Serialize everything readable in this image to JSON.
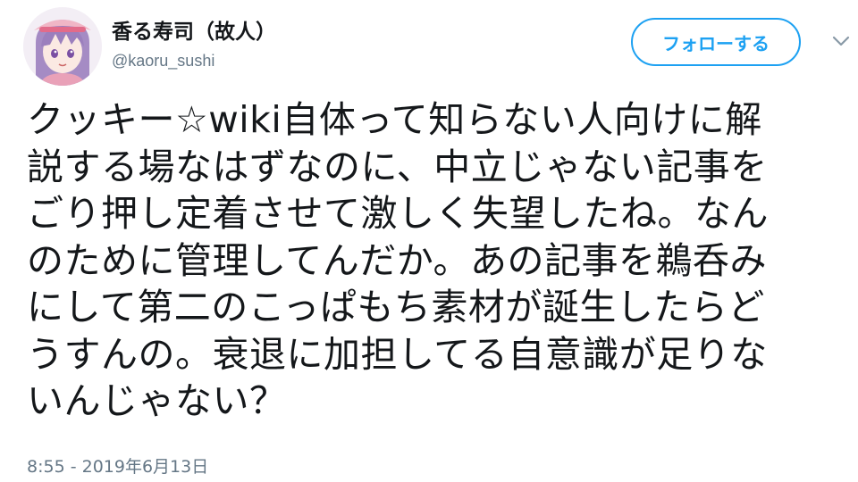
{
  "user": {
    "display_name": "香る寿司（故人）",
    "handle": "@kaoru_sushi",
    "avatar_icon": "anime-avatar-icon"
  },
  "follow_button": {
    "label": "フォローする",
    "color": "#1da1f2"
  },
  "menu": {
    "icon": "chevron-down-icon"
  },
  "tweet": {
    "lines": [
      "クッキー☆wiki自体って知らない人向けに解",
      "説する場なはずなのに、中立じゃない記事を",
      "ごり押し定着させて激しく失望したね。なん",
      "のために管理してんだか。あの記事を鵜呑み",
      "にして第二のこっぱもち素材が誕生したらど",
      "うすんの。衰退に加担してる自意識が足りな",
      "いんじゃない？"
    ],
    "timestamp": "8:55 - 2019年6月13日"
  }
}
